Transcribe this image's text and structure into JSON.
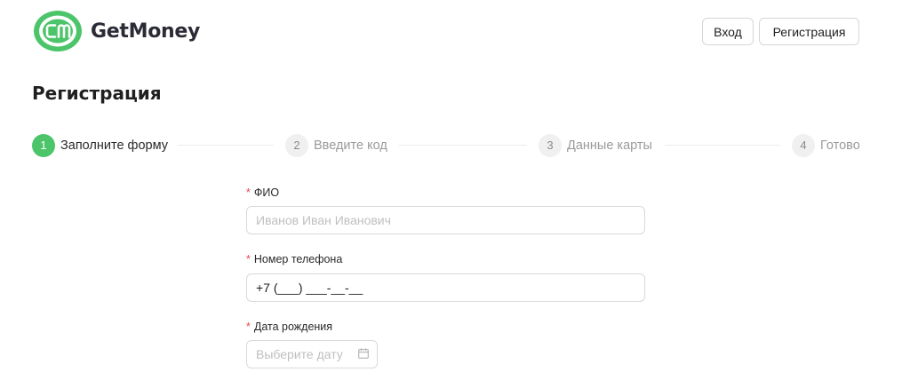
{
  "header": {
    "logo_mark": "GM",
    "brand": "GetMoney",
    "login_label": "Вход",
    "register_label": "Регистрация"
  },
  "page": {
    "title": "Регистрация"
  },
  "steps": [
    {
      "num": "1",
      "label": "Заполните форму",
      "active": true
    },
    {
      "num": "2",
      "label": "Введите код",
      "active": false
    },
    {
      "num": "3",
      "label": "Данные карты",
      "active": false
    },
    {
      "num": "4",
      "label": "Готово",
      "active": false
    }
  ],
  "form": {
    "required_mark": "*",
    "fio": {
      "label": "ФИО",
      "placeholder": "Иванов Иван Иванович",
      "value": ""
    },
    "phone": {
      "label": "Номер телефона",
      "value": "+7 (___) ___-__-__"
    },
    "birthdate": {
      "label": "Дата рождения",
      "placeholder": "Выберите дату",
      "icon": "calendar-icon"
    }
  },
  "colors": {
    "accent": "#4cc56a",
    "required": "#e34b4b",
    "text": "#1f1f1f",
    "muted": "#9a9a9a"
  }
}
